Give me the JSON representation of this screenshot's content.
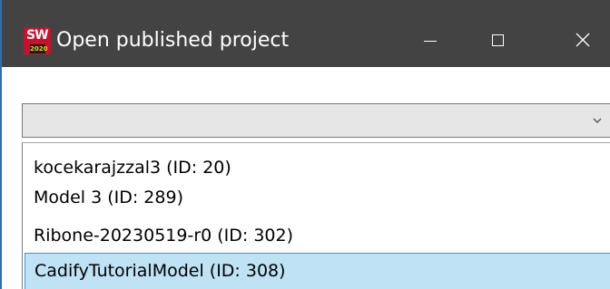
{
  "window": {
    "title": "Open published project",
    "icon": "solidworks-2020-icon",
    "icon_text": "SW",
    "icon_year": "2020",
    "controls": [
      "minimize",
      "maximize",
      "close"
    ],
    "close_glyph": "✕"
  },
  "combo": {
    "selected": "",
    "arrow_icon": "chevron-down-icon"
  },
  "projects": [
    {
      "label": "kocekarajzzal3 (ID: 20)"
    },
    {
      "label": "Model 3 (ID: 289)"
    },
    {
      "label": "Ribone-20230519-r0 (ID: 302)"
    },
    {
      "label": "CadifyTutorialModel (ID: 308)",
      "highlighted": true
    }
  ],
  "colors": {
    "titlebar": "#434343",
    "highlight": "#bfe3f5",
    "highlight_border": "#3c9ad6",
    "icon_red": "#c8102e"
  }
}
